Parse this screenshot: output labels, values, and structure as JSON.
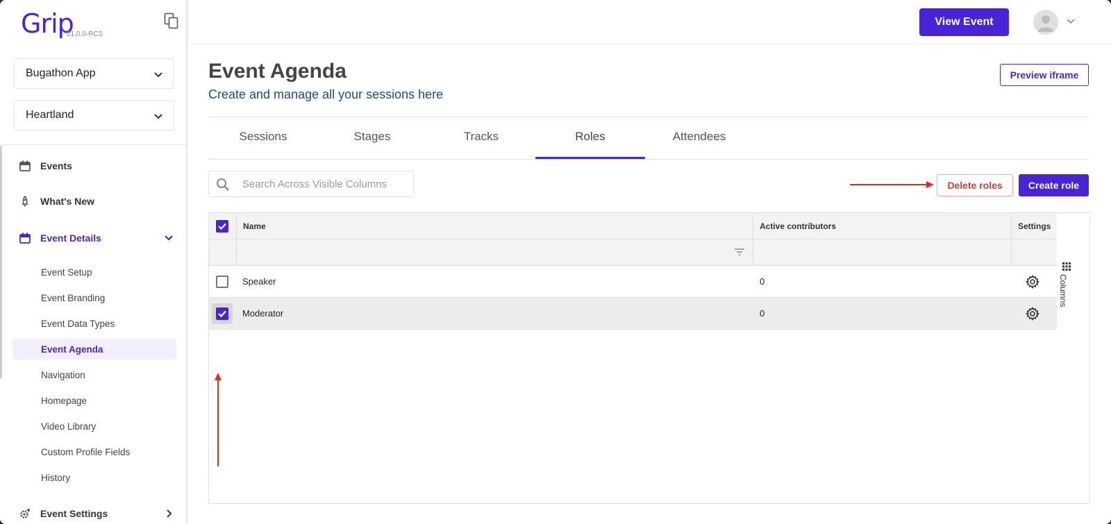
{
  "app": {
    "logo_text": "Grip",
    "version": "21.0.0-RC3"
  },
  "sidebar": {
    "app_select": "Bugathon App",
    "event_select": "Heartland",
    "nav": {
      "events": "Events",
      "whats_new": "What's New",
      "event_details": "Event Details",
      "event_settings": "Event Settings"
    },
    "sub_items": [
      "Event Setup",
      "Event Branding",
      "Event Data Types",
      "Event Agenda",
      "Navigation",
      "Homepage",
      "Video Library",
      "Custom Profile Fields",
      "History"
    ],
    "active_sub_item": "Event Agenda"
  },
  "topbar": {
    "view_event_label": "View Event"
  },
  "page": {
    "title": "Event Agenda",
    "subtitle": "Create and manage all your sessions here",
    "preview_label": "Preview iframe"
  },
  "tabs": [
    "Sessions",
    "Stages",
    "Tracks",
    "Roles",
    "Attendees"
  ],
  "active_tab": "Roles",
  "toolbar": {
    "search_placeholder": "Search Across Visible Columns",
    "delete_label": "Delete roles",
    "create_label": "Create role"
  },
  "table": {
    "columns": [
      "Name",
      "Active contributors",
      "Settings"
    ],
    "header_checked": true,
    "rows": [
      {
        "name": "Speaker",
        "active_contributors": "0",
        "checked": false
      },
      {
        "name": "Moderator",
        "active_contributors": "0",
        "checked": true
      }
    ],
    "columns_panel_label": "Columns"
  },
  "colors": {
    "accent": "#4a23d9",
    "danger": "#e53935",
    "annotation_arrow": "#e8281f"
  },
  "icons": [
    "copy-icon",
    "calendar-icon",
    "rocket-icon",
    "gear-icon",
    "chevron-down-icon",
    "chevron-right-icon",
    "search-icon",
    "filter-icon",
    "columns-icon",
    "avatar-icon"
  ]
}
